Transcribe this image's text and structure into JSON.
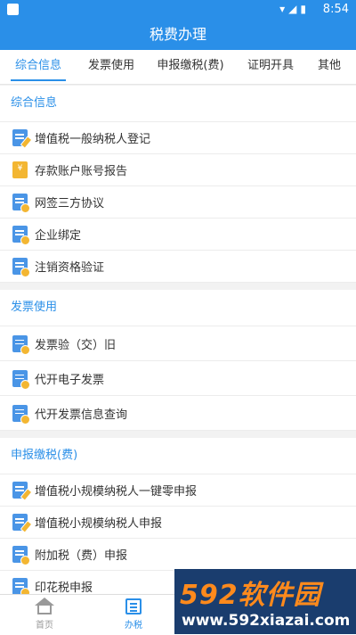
{
  "statusbar": {
    "icons": "▾◢▮",
    "time": "8:54"
  },
  "header": {
    "title": "税费办理"
  },
  "tabs": [
    {
      "label": "综合信息"
    },
    {
      "label": "发票使用"
    },
    {
      "label": "申报缴税(费)"
    },
    {
      "label": "证明开具"
    },
    {
      "label": "其他"
    }
  ],
  "sections": [
    {
      "title": "综合信息",
      "items": [
        "增值税一般纳税人登记",
        "存款账户账号报告",
        "网签三方协议",
        "企业绑定",
        "注销资格验证"
      ]
    },
    {
      "title": "发票使用",
      "items": [
        "发票验（交）旧",
        "代开电子发票",
        "代开发票信息查询"
      ]
    },
    {
      "title": "申报缴税(费)",
      "items": [
        "增值税小规模纳税人一键零申报",
        "增值税小规模纳税人申报",
        "附加税（费）申报",
        "印花税申报"
      ]
    }
  ],
  "icons": {
    "yuan_glyph": "¥"
  },
  "bottom_nav": [
    {
      "label": "首页"
    },
    {
      "label": "办税"
    }
  ],
  "watermark": {
    "brand": "592软件园",
    "url": "www.592xiazai.com"
  },
  "colors": {
    "accent": "#2a8fe8",
    "icon_badge": "#f3b632"
  }
}
